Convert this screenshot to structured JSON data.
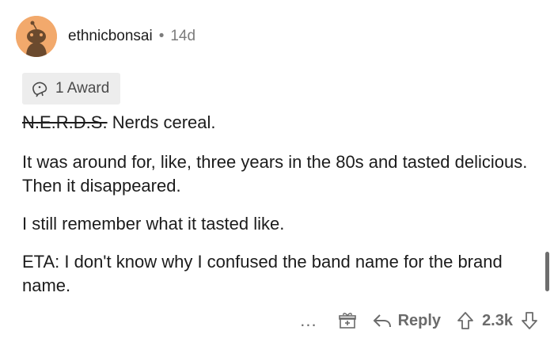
{
  "comment": {
    "author": "ethnicbonsai",
    "separator": "•",
    "age": "14d",
    "award_label": "1 Award",
    "body": {
      "line1_struck": "N.E.R.D.S.",
      "line1_rest": " Nerds cereal.",
      "para2": "It was around for, like, three years in the 80s and tasted delicious. Then it disappeared.",
      "para3": "I still remember what it tasted like.",
      "para4": "ETA: I don't know why I confused the band name for the brand name."
    }
  },
  "actions": {
    "more": "...",
    "reply_label": "Reply",
    "score": "2.3k"
  },
  "colors": {
    "avatar_bg": "#f2a96c",
    "meta_grey": "#7c7c7c",
    "award_bg": "#ededed"
  }
}
